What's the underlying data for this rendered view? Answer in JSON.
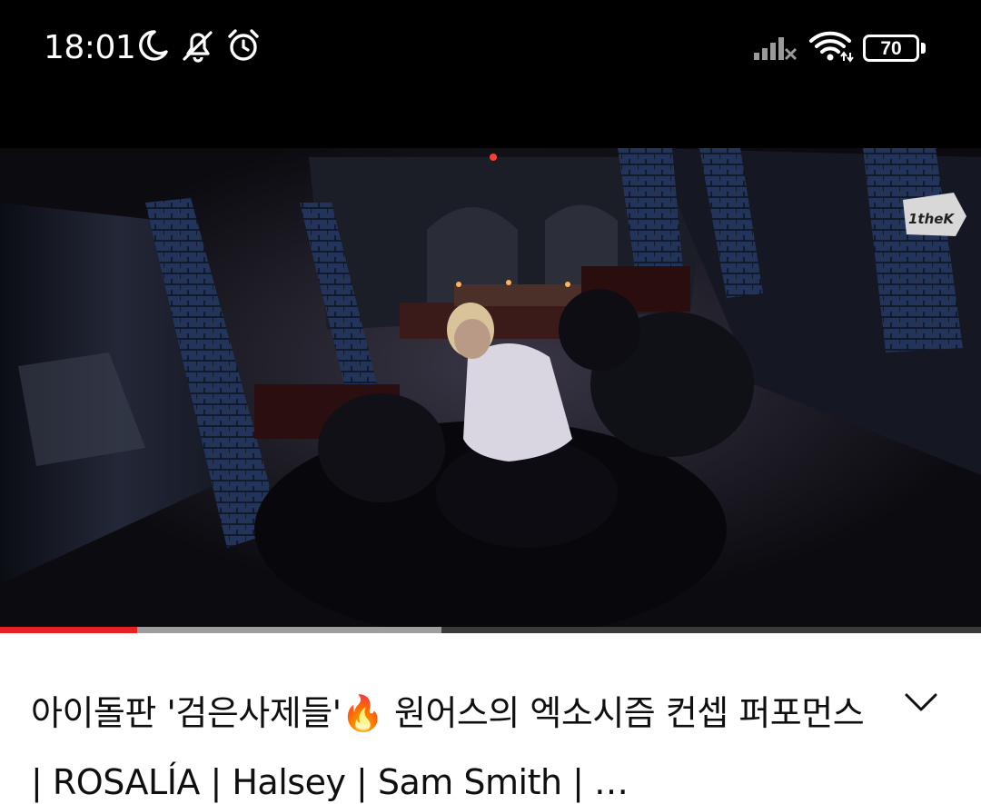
{
  "status_bar": {
    "time": "18:01",
    "battery": "70",
    "icons": [
      "moon-icon",
      "bell-off-icon",
      "alarm-icon",
      "signal-icon",
      "wifi-icon",
      "battery-icon"
    ]
  },
  "video": {
    "channel_logo": "1theK",
    "progress_played": 0.14,
    "progress_buffered": 0.45,
    "colors": {
      "played": "#e52121",
      "buffered": "#9e9e9e",
      "track": "#3a3a3a"
    }
  },
  "title": {
    "text": "아이돌판 '검은사제들'🔥 원어스의 엑소시즘 컨셉 퍼포먼스 | ROSALÍA | Halsey | Sam Smith | …"
  }
}
